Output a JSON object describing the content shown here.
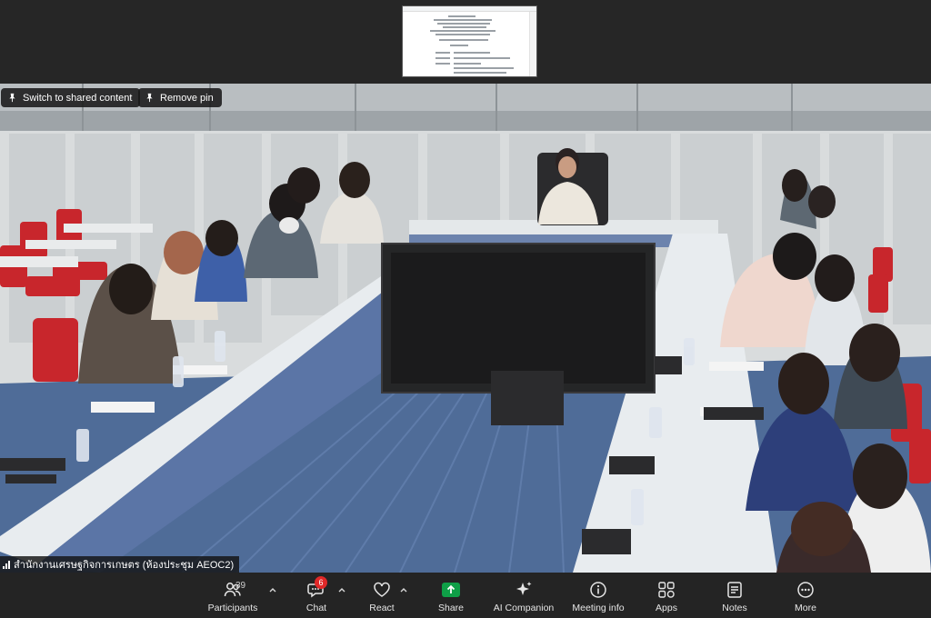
{
  "overlay": {
    "switch_label": "Switch to shared content",
    "remove_pin_label": "Remove pin",
    "participant_name": "สำนักงานเศรษฐกิจการเกษตร (ห้องประชุม AEOC2)"
  },
  "toolbar": {
    "participants_label": "Participants",
    "participants_count": "39",
    "chat_label": "Chat",
    "chat_badge": "6",
    "react_label": "React",
    "share_label": "Share",
    "ai_label": "AI Companion",
    "info_label": "Meeting info",
    "apps_label": "Apps",
    "notes_label": "Notes",
    "more_label": "More"
  },
  "colors": {
    "toolbar_bg": "#242424",
    "share_green": "#0e9f47",
    "badge_red": "#e02828"
  },
  "icons": [
    "pin-icon",
    "participants-icon",
    "chat-icon",
    "react-icon",
    "share-icon",
    "ai-companion-icon",
    "info-icon",
    "apps-icon",
    "notes-icon",
    "more-icon",
    "chevron-up-icon",
    "signal-icon"
  ]
}
